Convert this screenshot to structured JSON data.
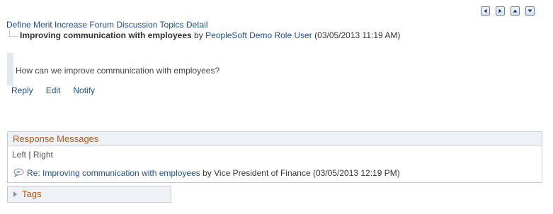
{
  "nav": {
    "buttons": [
      "previous",
      "next",
      "up",
      "down"
    ]
  },
  "title_link": "Define Merit Increase Forum Discussion Topics Detail",
  "post": {
    "title": "Improving communication with employees",
    "by": " by ",
    "author": "PeopleSoft Demo Role User",
    "timestamp": " (03/05/2013 11:19 AM)"
  },
  "message": "How can we improve communication with employees?",
  "actions": {
    "reply": "Reply",
    "edit": "Edit",
    "notify": "Notify"
  },
  "responses": {
    "header": "Response Messages",
    "left": "Left",
    "separator": " | ",
    "right": "Right",
    "items": [
      {
        "title": "Re: Improving communication with employees",
        "by": " by Vice President of Finance",
        "timestamp": " (03/05/2013 12:19 PM)"
      }
    ]
  },
  "tags": {
    "label": "Tags"
  },
  "colors": {
    "link": "#1f4f8a",
    "section_header": "#b0591c",
    "panel_border": "#c5ccd6"
  }
}
